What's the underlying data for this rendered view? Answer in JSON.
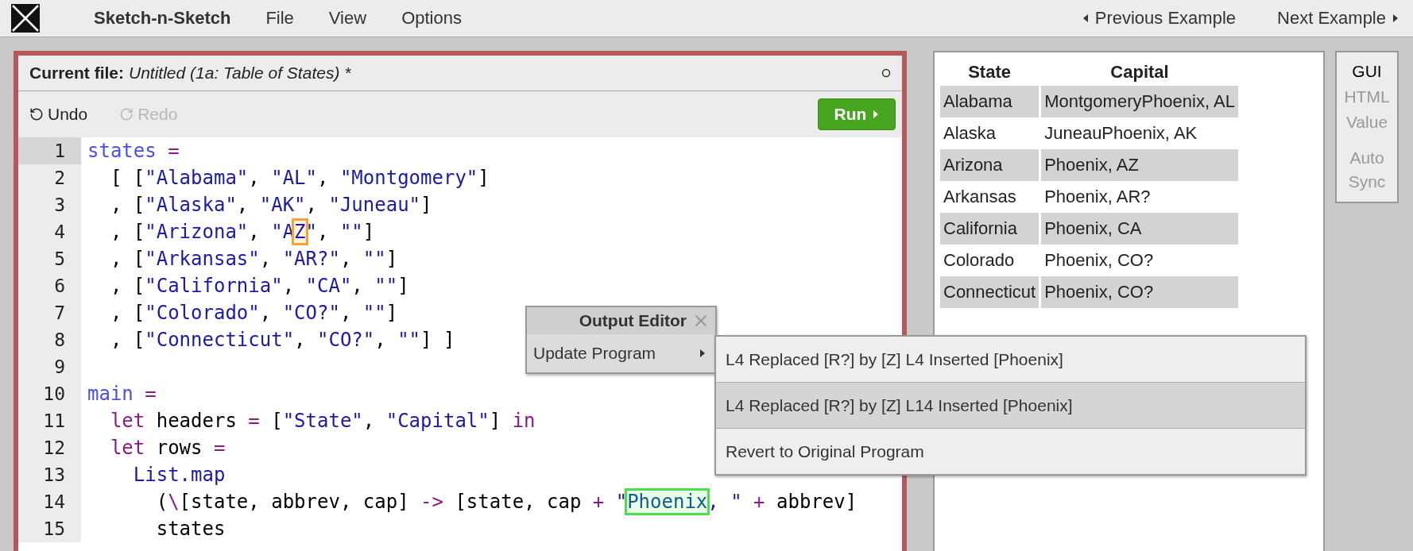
{
  "menubar": {
    "app_name": "Sketch-n-Sketch",
    "menus": [
      "File",
      "View",
      "Options"
    ],
    "previous": "Previous Example",
    "next": "Next Example"
  },
  "editor": {
    "file_label": "Current file:",
    "file_name": "Untitled (1a: Table of States) *",
    "toolbar": [
      {
        "label": "Undo",
        "disabled": false
      },
      {
        "label": "Redo",
        "disabled": true
      }
    ],
    "run_label": "Run",
    "lines": [
      {
        "number": "1",
        "active": true,
        "tokens": [
          {
            "text": "states",
            "kind": "def"
          },
          {
            "text": " =",
            "kind": "op"
          }
        ]
      },
      {
        "number": "2",
        "active": false,
        "tokens": [
          {
            "text": "  [ [",
            "kind": "plain"
          },
          {
            "text": "\"Alabama\"",
            "kind": "string"
          },
          {
            "text": ", ",
            "kind": "plain"
          },
          {
            "text": "\"AL\"",
            "kind": "string"
          },
          {
            "text": ", ",
            "kind": "plain"
          },
          {
            "text": "\"Montgomery\"",
            "kind": "string"
          },
          {
            "text": "]",
            "kind": "plain"
          }
        ]
      },
      {
        "number": "3",
        "active": false,
        "tokens": [
          {
            "text": "  , [",
            "kind": "plain"
          },
          {
            "text": "\"Alaska\"",
            "kind": "string"
          },
          {
            "text": ", ",
            "kind": "plain"
          },
          {
            "text": "\"AK\"",
            "kind": "string"
          },
          {
            "text": ", ",
            "kind": "plain"
          },
          {
            "text": "\"Juneau\"",
            "kind": "string"
          },
          {
            "text": "]",
            "kind": "plain"
          }
        ]
      },
      {
        "number": "4",
        "active": false,
        "tokens": [
          {
            "text": "  , [",
            "kind": "plain"
          },
          {
            "text": "\"Arizona\"",
            "kind": "string"
          },
          {
            "text": ", ",
            "kind": "plain"
          },
          {
            "text": "\"A",
            "kind": "string"
          },
          {
            "text": "Z",
            "kind": "replaced"
          },
          {
            "text": "\"",
            "kind": "string"
          },
          {
            "text": ", ",
            "kind": "plain"
          },
          {
            "text": "\"\"",
            "kind": "string"
          },
          {
            "text": "]",
            "kind": "plain"
          }
        ]
      },
      {
        "number": "5",
        "active": false,
        "tokens": [
          {
            "text": "  , [",
            "kind": "plain"
          },
          {
            "text": "\"Arkansas\"",
            "kind": "string"
          },
          {
            "text": ", ",
            "kind": "plain"
          },
          {
            "text": "\"AR?\"",
            "kind": "string"
          },
          {
            "text": ", ",
            "kind": "plain"
          },
          {
            "text": "\"\"",
            "kind": "string"
          },
          {
            "text": "]",
            "kind": "plain"
          }
        ]
      },
      {
        "number": "6",
        "active": false,
        "tokens": [
          {
            "text": "  , [",
            "kind": "plain"
          },
          {
            "text": "\"California\"",
            "kind": "string"
          },
          {
            "text": ", ",
            "kind": "plain"
          },
          {
            "text": "\"CA\"",
            "kind": "string"
          },
          {
            "text": ", ",
            "kind": "plain"
          },
          {
            "text": "\"\"",
            "kind": "string"
          },
          {
            "text": "]",
            "kind": "plain"
          }
        ]
      },
      {
        "number": "7",
        "active": false,
        "tokens": [
          {
            "text": "  , [",
            "kind": "plain"
          },
          {
            "text": "\"Colorado\"",
            "kind": "string"
          },
          {
            "text": ", ",
            "kind": "plain"
          },
          {
            "text": "\"CO?\"",
            "kind": "string"
          },
          {
            "text": ", ",
            "kind": "plain"
          },
          {
            "text": "\"\"",
            "kind": "string"
          },
          {
            "text": "]",
            "kind": "plain"
          }
        ]
      },
      {
        "number": "8",
        "active": false,
        "tokens": [
          {
            "text": "  , [",
            "kind": "plain"
          },
          {
            "text": "\"Connecticut\"",
            "kind": "string"
          },
          {
            "text": ", ",
            "kind": "plain"
          },
          {
            "text": "\"CO?\"",
            "kind": "string"
          },
          {
            "text": ", ",
            "kind": "plain"
          },
          {
            "text": "\"\"",
            "kind": "string"
          },
          {
            "text": "] ]",
            "kind": "plain"
          }
        ]
      },
      {
        "number": "9",
        "active": false
      },
      {
        "number": "10",
        "active": false,
        "tokens": [
          {
            "text": "main",
            "kind": "def"
          },
          {
            "text": " =",
            "kind": "op"
          }
        ]
      },
      {
        "number": "11",
        "active": false,
        "tokens": [
          {
            "text": "  let",
            "kind": "keyword"
          },
          {
            "text": " headers ",
            "kind": "plain"
          },
          {
            "text": "=",
            "kind": "op"
          },
          {
            "text": " [",
            "kind": "plain"
          },
          {
            "text": "\"State\"",
            "kind": "string"
          },
          {
            "text": ", ",
            "kind": "plain"
          },
          {
            "text": "\"Capital\"",
            "kind": "string"
          },
          {
            "text": "] ",
            "kind": "plain"
          },
          {
            "text": "in",
            "kind": "keyword"
          }
        ]
      },
      {
        "number": "12",
        "active": false,
        "tokens": [
          {
            "text": "  let",
            "kind": "keyword"
          },
          {
            "text": " rows ",
            "kind": "plain"
          },
          {
            "text": "=",
            "kind": "op"
          }
        ]
      },
      {
        "number": "13",
        "active": false,
        "tokens": [
          {
            "text": "    List.map",
            "kind": "fn"
          }
        ]
      },
      {
        "number": "14",
        "active": false,
        "tokens": [
          {
            "text": "      (",
            "kind": "plain"
          },
          {
            "text": "\\",
            "kind": "op"
          },
          {
            "text": "[state, abbrev, cap] ",
            "kind": "plain"
          },
          {
            "text": "->",
            "kind": "op"
          },
          {
            "text": " [state, cap ",
            "kind": "plain"
          },
          {
            "text": "+",
            "kind": "op"
          },
          {
            "text": " \"",
            "kind": "string"
          },
          {
            "text": "Phoenix",
            "kind": "inserted"
          },
          {
            "text": ", \"",
            "kind": "string"
          },
          {
            "text": " +",
            "kind": "op"
          },
          {
            "text": " abbrev]",
            "kind": "plain"
          }
        ]
      },
      {
        "number": "15",
        "active": false,
        "tokens": [
          {
            "text": "      states",
            "kind": "plain"
          }
        ]
      }
    ]
  },
  "output": {
    "columns": [
      "State",
      "Capital"
    ],
    "rows": [
      [
        "Alabama",
        "MontgomeryPhoenix, AL"
      ],
      [
        "Alaska",
        "JuneauPhoenix, AK"
      ],
      [
        "Arizona",
        "Phoenix, AZ"
      ],
      [
        "Arkansas",
        "Phoenix, AR?"
      ],
      [
        "California",
        "Phoenix, CA"
      ],
      [
        "Colorado",
        "Phoenix, CO?"
      ],
      [
        "Connecticut",
        "Phoenix, CO?"
      ]
    ]
  },
  "view_modes": [
    {
      "label": "GUI",
      "selected": true
    },
    {
      "label": "HTML",
      "selected": false
    },
    {
      "label": "Value",
      "selected": false
    }
  ],
  "auto_sync": {
    "label": "Auto Sync",
    "on": false
  },
  "output_editor": {
    "title": "Output Editor",
    "item": {
      "label": "Update Program",
      "expanded": true
    },
    "submenu": [
      {
        "label": "L4 Replaced [R?] by [Z] L4 Inserted [Phoenix]",
        "selected": false
      },
      {
        "label": "L4 Replaced [R?] by [Z] L14 Inserted [Phoenix]",
        "selected": true
      },
      {
        "label": "Revert to Original Program",
        "selected": false
      }
    ]
  }
}
